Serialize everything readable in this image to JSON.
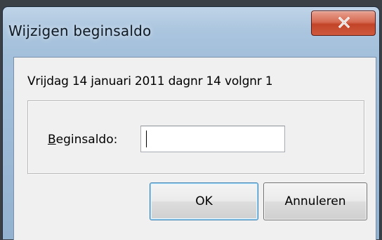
{
  "window": {
    "title": "Wijzigen beginsaldo"
  },
  "info": {
    "text": "Vrijdag 14 januari 2011 dagnr 14 volgnr 1"
  },
  "form": {
    "label_mnemonic": "B",
    "label_rest": "eginsaldo:",
    "input_value": ""
  },
  "buttons": {
    "ok_label": "OK",
    "cancel_label": "Annuleren"
  },
  "colors": {
    "titlebar": "#9fbcd8",
    "close_button": "#c24428",
    "client_background": "#f0f0f0",
    "default_button_border": "#3c7fb1"
  },
  "icons": {
    "close": "close-icon"
  }
}
